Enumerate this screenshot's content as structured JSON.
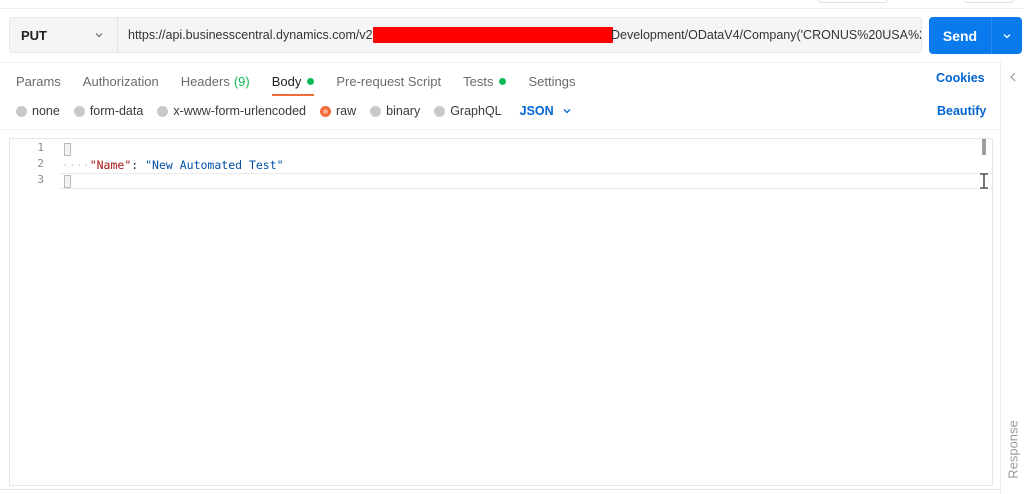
{
  "request": {
    "method": "PUT",
    "url_start": "https://api.businesscentral.dynamics.com/v2.0/",
    "url_end": "Development/ODataV4/Company('CRONUS%20USA%2(...",
    "send_label": "Send"
  },
  "tabs": [
    {
      "label": "Params"
    },
    {
      "label": "Authorization"
    },
    {
      "label": "Headers",
      "count": "(9)"
    },
    {
      "label": "Body"
    },
    {
      "label": "Pre-request Script"
    },
    {
      "label": "Tests"
    },
    {
      "label": "Settings"
    }
  ],
  "cookies_label": "Cookies",
  "body_types": [
    {
      "label": "none"
    },
    {
      "label": "form-data"
    },
    {
      "label": "x-www-form-urlencoded"
    },
    {
      "label": "raw"
    },
    {
      "label": "binary"
    },
    {
      "label": "GraphQL"
    }
  ],
  "language": "JSON",
  "beautify_label": "Beautify",
  "editor": {
    "line_numbers": [
      "1",
      "2",
      "3"
    ],
    "line2_indent": "····",
    "line2_key": "\"Name\"",
    "line2_colon": ": ",
    "line2_value": "\"New Automated Test\""
  },
  "side_panel_label": "Response",
  "colors": {
    "accent": "#f26b3a",
    "send_button": "#097bed",
    "link": "#0265d2",
    "status_green": "#0cbb52",
    "redaction": "#ff0000"
  }
}
